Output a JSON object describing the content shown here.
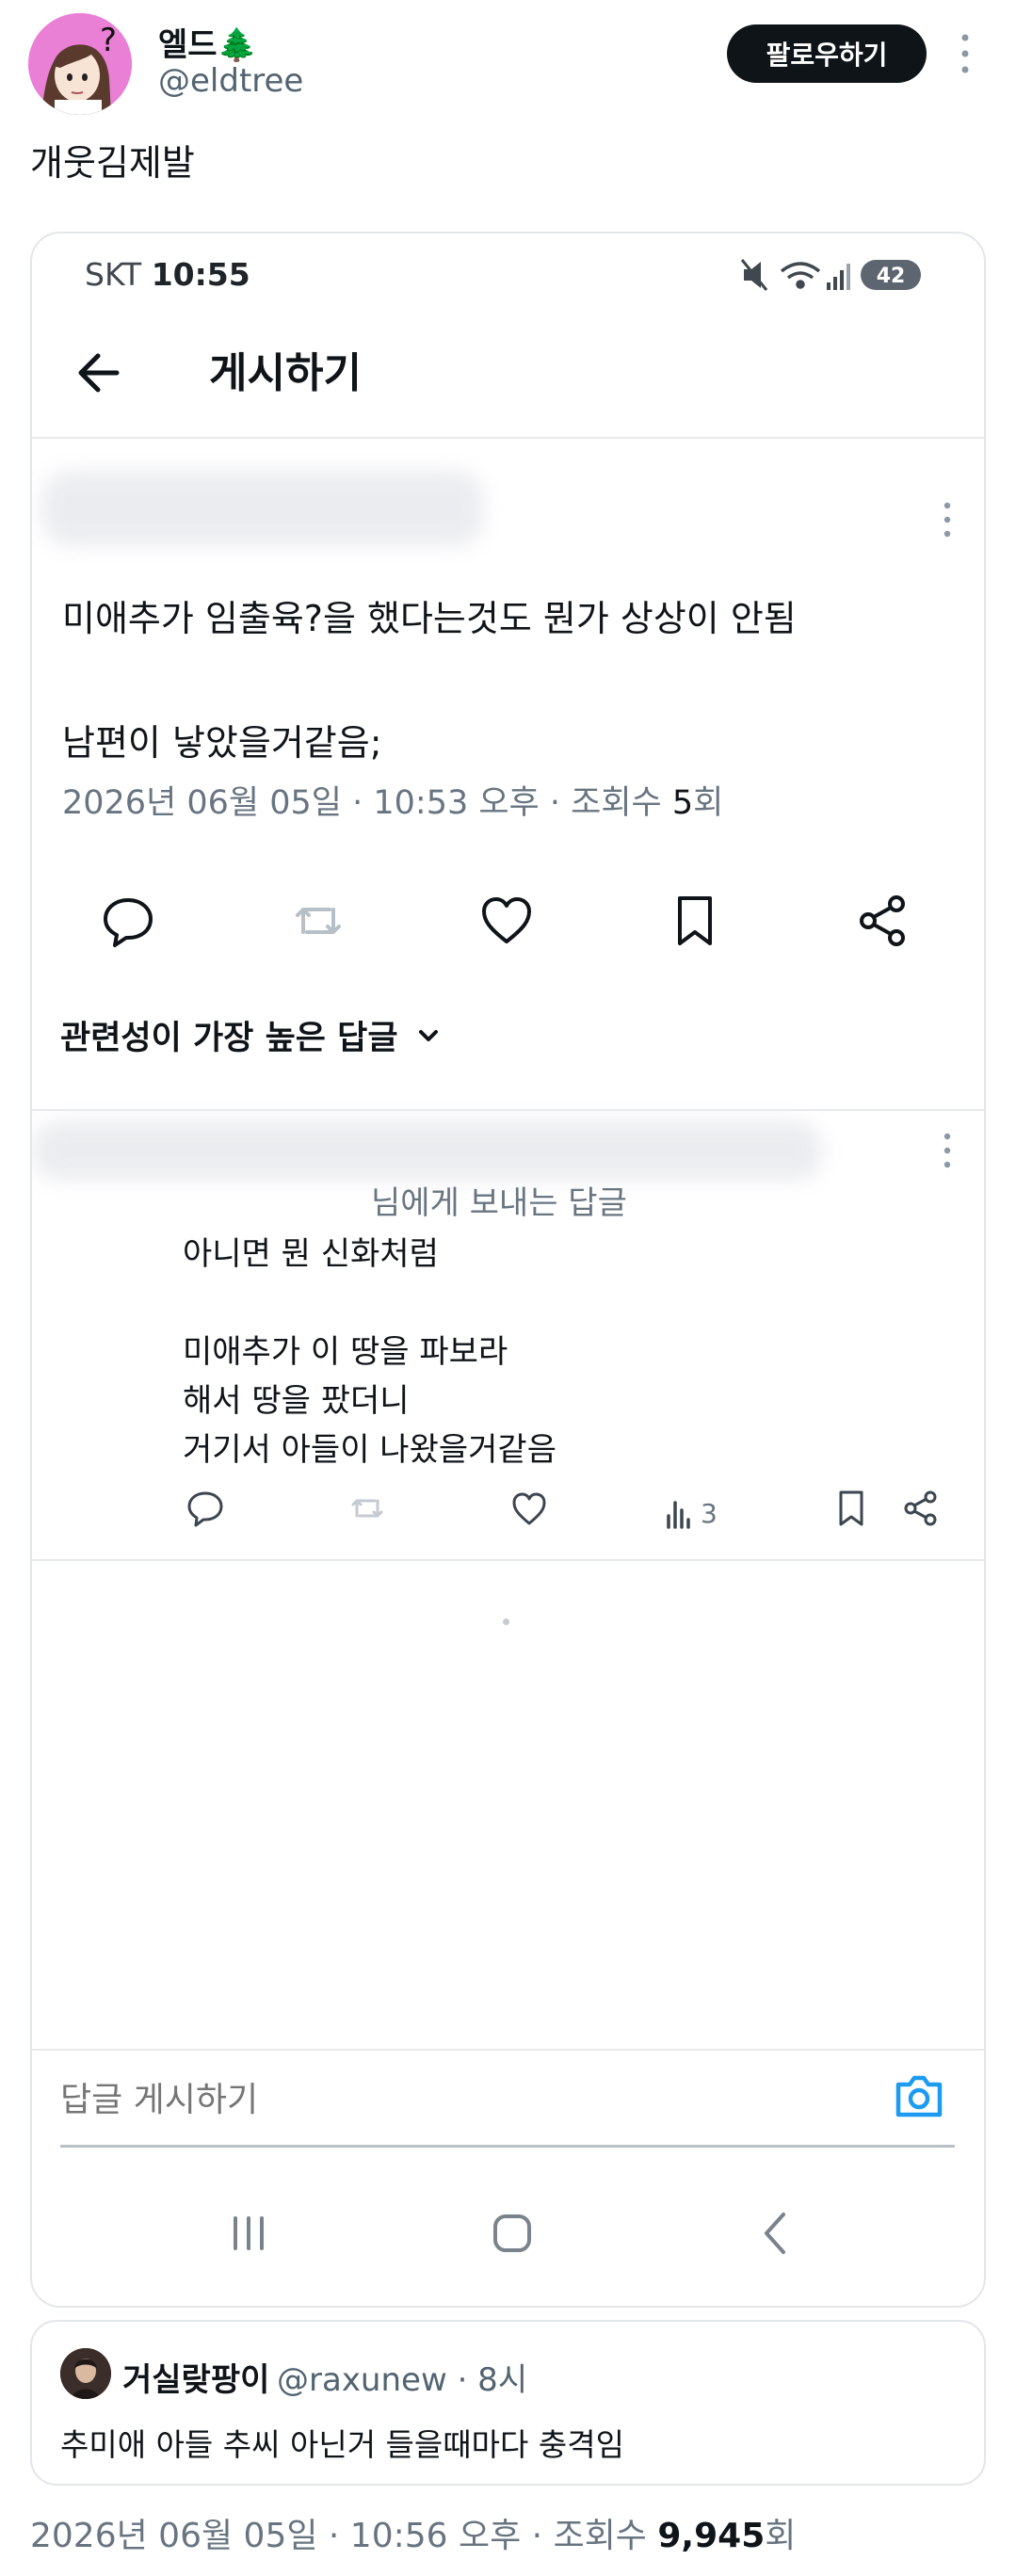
{
  "tweet": {
    "display_name": "엘드🌲",
    "handle": "@eldtree",
    "follow_label": "팔로우하기",
    "text": "개웃김제발",
    "avatar_icon": "cartoon-girl-question-avatar"
  },
  "screenshot": {
    "status": {
      "carrier": "SKT",
      "time": "10:55",
      "battery": "42"
    },
    "title": "게시하기",
    "post": {
      "line1": "미애추가 임출육?을 했다는것도 뭔가 상상이 안됨",
      "line2": "남편이 낳았을거같음;",
      "meta_prefix": "2026년 06월 05일 · 10:53 오후 · 조회수 ",
      "views": "5",
      "views_suffix": "회"
    },
    "relevant_label": "관련성이 가장 높은 답글",
    "reply": {
      "reply_to": "님에게 보내는 답글",
      "lines": [
        "아니면 뭔 신화처럼",
        "미애추가 이 땅을 파보라",
        "해서 땅을 팠더니",
        "거기서 아들이 나왔을거같음"
      ],
      "view_count": "3"
    },
    "reply_placeholder": "답글 게시하기"
  },
  "quote": {
    "name": "거실랒팡이",
    "handle": "@raxunew · 8시",
    "text": "추미애 아들 추씨 아닌거 들을때마다 충격임"
  },
  "footer": {
    "meta_prefix": "2026년 06월 05일 · 10:56 오후 · 조회수 ",
    "views": "9,945",
    "views_suffix": "회"
  },
  "colors": {
    "text": "#0f1419",
    "muted": "#687581",
    "accent_camera": "#1d9bf0",
    "avatar_bg": "#ea7fd6"
  }
}
